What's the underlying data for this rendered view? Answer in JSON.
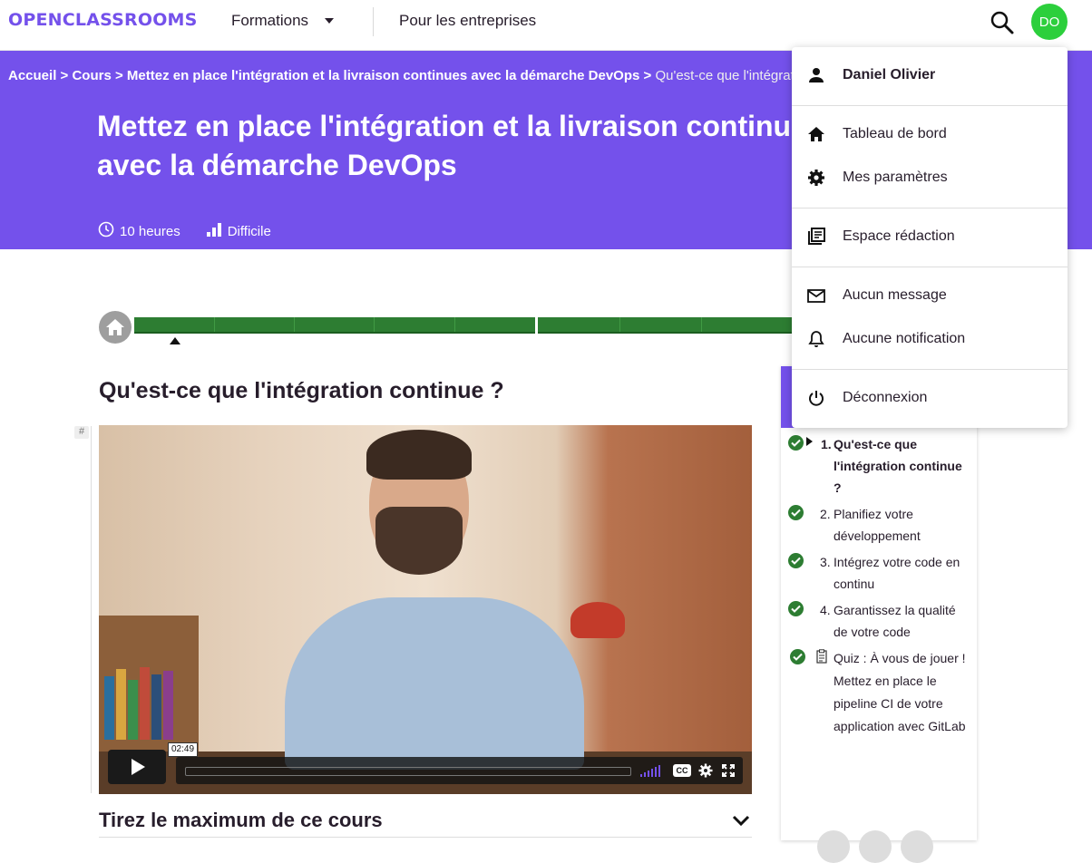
{
  "header": {
    "logo": "OPENCLASSROOMS",
    "formations_label": "Formations",
    "entreprises_label": "Pour les entreprises",
    "avatar_initials": "DO"
  },
  "hero": {
    "breadcrumb": {
      "home": "Accueil",
      "sep": ">",
      "courses": "Cours",
      "course": "Mettez en place l'intégration et la livraison continues avec la démarche DevOps",
      "current": "Qu'est-ce que l'intégration continue ?"
    },
    "title_line1": "Mettez en place l'intégration et la livraison continues",
    "title_line2": "avec la démarche DevOps",
    "duration": "10 heures",
    "difficulty": "Difficile"
  },
  "content": {
    "chapter_title": "Qu'est-ce que l'intégration continue ?",
    "anchor_symbol": "#",
    "video": {
      "time": "02:49",
      "cc_label": "CC"
    },
    "accordion_title": "Tirez le maximum de ce cours"
  },
  "sidebar": {
    "items": [
      {
        "number": "1.",
        "label": "Qu'est-ce que l'intégration continue ?",
        "active": true
      },
      {
        "number": "2.",
        "label": "Planifiez votre développement",
        "active": false
      },
      {
        "number": "3.",
        "label": "Intégrez votre code en continu",
        "active": false
      },
      {
        "number": "4.",
        "label": "Garantissez la qualité de votre code",
        "active": false
      },
      {
        "number": "",
        "label": "Quiz : À vous de jouer ! Mettez en place le pipeline CI de votre application avec GitLab",
        "active": false
      }
    ]
  },
  "user_menu": {
    "user_name": "Daniel Olivier",
    "dashboard": "Tableau de bord",
    "settings": "Mes paramètres",
    "writing_space": "Espace rédaction",
    "messages": "Aucun message",
    "notifications": "Aucune notification",
    "logout": "Déconnexion"
  },
  "colors": {
    "brand": "#7451eb",
    "progress_green": "#2d7d32",
    "avatar_green": "#2ccf3c"
  }
}
